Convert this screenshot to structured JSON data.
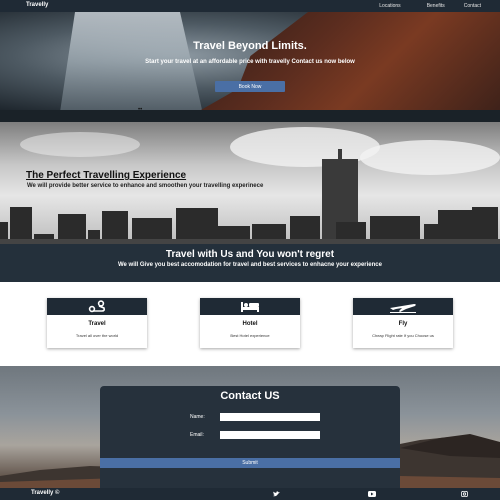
{
  "nav": {
    "brand": "Travelly",
    "links": [
      "Locations",
      "Benefits",
      "Contact"
    ]
  },
  "hero": {
    "title": "Travel Beyond Limits.",
    "subtitle": "Start your travel at an affordable price with travelly Contact us now below",
    "button_label": "Book Now",
    "dots": "••"
  },
  "city": {
    "title": "The Perfect Travelling Experience",
    "subtitle": "We will provide better service to enhance and smoothen your travelling experinece"
  },
  "band": {
    "title": "Travel with Us and You won't regret",
    "subtitle": "We will Give you best accomodation for travel and best services to enhacne your experience"
  },
  "cards": [
    {
      "icon": "route-icon",
      "title": "Travel",
      "desc": "Travel all over the world"
    },
    {
      "icon": "bed-icon",
      "title": "Hotel",
      "desc": "Best Hotel experience"
    },
    {
      "icon": "plane-icon",
      "title": "Fly",
      "desc": "Cheap Flight rate If you Choose us"
    }
  ],
  "contact": {
    "title": "Contact US",
    "name_label": "Name:",
    "email_label": "Email:",
    "name_value": "",
    "email_value": "",
    "submit_label": "Submit"
  },
  "footer": {
    "brand": "Travelly ©",
    "icons": [
      "twitter-icon",
      "youtube-icon",
      "instagram-icon"
    ]
  },
  "colors": {
    "nav_bg": "#1f2a35",
    "accent": "#4a6fa5",
    "band_bg": "#24303b"
  }
}
